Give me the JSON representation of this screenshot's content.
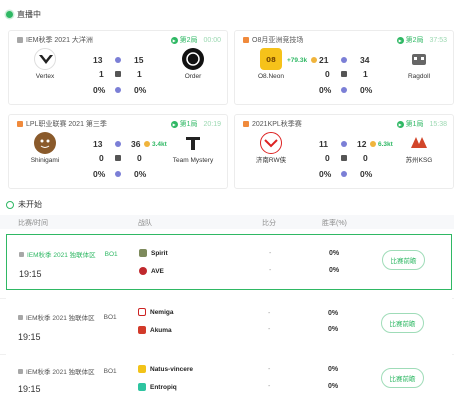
{
  "live": {
    "title": "直播中"
  },
  "pending": {
    "title": "未开始"
  },
  "cards": [
    {
      "league": "IEM秋季 2021 大洋洲",
      "status": "第2局",
      "time": "00:00",
      "left": {
        "name": "Vertex",
        "top": "13",
        "mid": "1",
        "pct": "0%"
      },
      "right": {
        "name": "Order",
        "top": "15",
        "mid": "1",
        "pct": "0%"
      },
      "gain_left": "",
      "gain_right": ""
    },
    {
      "league": "O8月亚洲竞技场",
      "status": "第2局",
      "time": "37:53",
      "left": {
        "name": "O8.Neon",
        "top": "21",
        "mid": "0",
        "pct": "0%"
      },
      "right": {
        "name": "Ragdoll",
        "top": "34",
        "mid": "1",
        "pct": "0%"
      },
      "gain_left": "+79.3k",
      "gain_right": ""
    },
    {
      "league": "LPL职业联赛 2021 第三季",
      "status": "第1局",
      "time": "20:19",
      "left": {
        "name": "Shinigami",
        "top": "13",
        "mid": "0",
        "pct": "0%"
      },
      "right": {
        "name": "Team Mystery",
        "top": "36",
        "mid": "0",
        "pct": "0%"
      },
      "gain_left": "",
      "gain_right": "3.4kt"
    },
    {
      "league": "2021KPL秋季赛",
      "status": "第1局",
      "time": "15:38",
      "left": {
        "name": "济南RW侠",
        "top": "11",
        "mid": "0",
        "pct": "0%"
      },
      "right": {
        "name": "苏州KSG",
        "top": "12",
        "mid": "0",
        "pct": "0%"
      },
      "gain_left": "",
      "gain_right": "6.3kt"
    }
  ],
  "table_head": {
    "match": "比赛/时间",
    "team": "战队",
    "score": "比分",
    "odds": "胜率(%)"
  },
  "rows": [
    {
      "league": "IEM秋季 2021 独联体区",
      "bo": "BO1",
      "time": "19:15",
      "team1": "Spirit",
      "team2": "AVE",
      "s1": "-",
      "s2": "-",
      "p1": "0%",
      "p2": "0%",
      "btn": "比赛前瞻"
    },
    {
      "league": "IEM秋季 2021 独联体区",
      "bo": "BO1",
      "time": "19:15",
      "team1": "Nemiga",
      "team2": "Akuma",
      "s1": "-",
      "s2": "-",
      "p1": "0%",
      "p2": "0%",
      "btn": "比赛前瞻"
    },
    {
      "league": "IEM秋季 2021 独联体区",
      "bo": "BO1",
      "time": "19:15",
      "team1": "Natus-vincere",
      "team2": "Entropiq",
      "s1": "-",
      "s2": "-",
      "p1": "0%",
      "p2": "0%",
      "btn": "比赛前瞻"
    }
  ],
  "colors": {
    "accent": "#2fb864"
  }
}
